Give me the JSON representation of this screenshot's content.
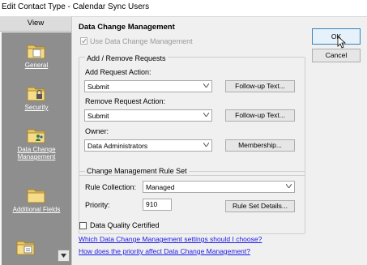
{
  "window": {
    "title": "Edit Contact Type - Calendar Sync Users"
  },
  "sidebar": {
    "header": "View",
    "items": [
      {
        "label": "General",
        "icon": "folder-icon"
      },
      {
        "label": "Security",
        "icon": "folder-lock-icon"
      },
      {
        "label": "Data Change Management",
        "label_lines": [
          "Data Change",
          "Management"
        ],
        "icon": "folder-people-icon"
      },
      {
        "label": "Additional Fields",
        "icon": "folder-icon"
      },
      {
        "label": "",
        "icon": "folder-list-icon"
      }
    ]
  },
  "main": {
    "title": "Data Change Management",
    "use_dcm_label": "Use Data Change Management",
    "requests_group": {
      "legend": "Add / Remove Requests",
      "add_label": "Add Request Action:",
      "add_value": "Submit",
      "add_followup": "Follow-up Text...",
      "remove_label": "Remove Request Action:",
      "remove_value": "Submit",
      "remove_followup": "Follow-up Text...",
      "owner_label": "Owner:",
      "owner_value": "Data Administrators",
      "membership": "Membership..."
    },
    "rules_group": {
      "legend": "Change Management Rule Set",
      "collection_label": "Rule Collection:",
      "collection_value": "Managed",
      "priority_label": "Priority:",
      "priority_value": "910",
      "details_button": "Rule Set Details..."
    },
    "quality_label": "Data Quality Certified",
    "links": [
      "Which Data Change Management settings should I choose?",
      "How does the priority affect Data Change Management?"
    ]
  },
  "buttons": {
    "ok": "OK",
    "cancel": "Cancel"
  }
}
